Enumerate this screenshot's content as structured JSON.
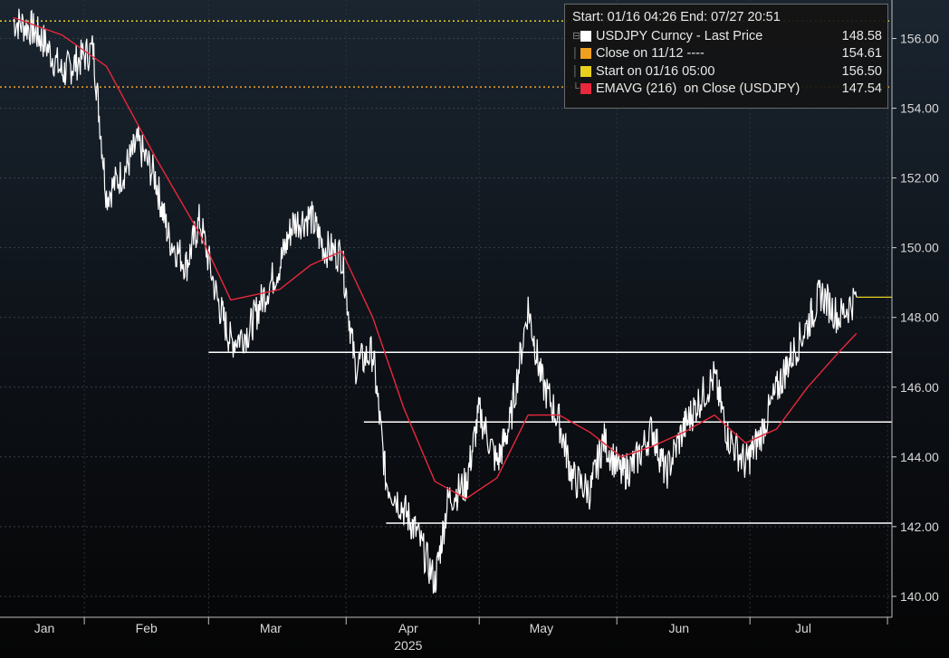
{
  "colors": {
    "background": "#0a0a0a",
    "price_line": "#ffffff",
    "ema_line": "#e8283c",
    "close_marker": "#f0a020",
    "start_marker": "#e8d020",
    "support_lines": "#ffffff",
    "last_price_tick": "#e8d020"
  },
  "legend": {
    "header": "Start: 01/16 04:26 End: 07/27 20:51",
    "items": [
      {
        "label": "USDJPY Curncy - Last Price",
        "value": "148.58",
        "color": "#ffffff"
      },
      {
        "label": "Close on 11/12 ----",
        "value": "154.61",
        "color": "#f0a020"
      },
      {
        "label": "Start on 01/16 05:00",
        "value": "156.50",
        "color": "#e8d020"
      },
      {
        "label": "EMAVG (216)  on Close (USDJPY)",
        "value": "147.54",
        "color": "#e8283c"
      }
    ]
  },
  "chart_data": {
    "type": "line",
    "title": "",
    "ylim": [
      139.4,
      157.0
    ],
    "y_ticks": [
      "140.00",
      "142.00",
      "144.00",
      "146.00",
      "148.00",
      "150.00",
      "152.00",
      "154.00",
      "156.00"
    ],
    "x_months": [
      "Jan",
      "Feb",
      "Mar",
      "Apr",
      "May",
      "Jun",
      "Jul"
    ],
    "x_year": "2025",
    "horizontal_lines": [
      {
        "name": "Close on 11/12",
        "value": 154.61,
        "style": "dotted"
      },
      {
        "name": "Start on 01/16 05:00",
        "value": 156.5,
        "style": "dotted"
      },
      {
        "value": 147.0,
        "from": "03/01"
      },
      {
        "value": 145.0,
        "from": "04/05"
      },
      {
        "value": 142.1,
        "from": "04/10"
      }
    ],
    "series": [
      {
        "name": "USDJPY Curncy - Last Price",
        "x": [
          "01/16",
          "01/20",
          "01/23",
          "01/27",
          "01/30",
          "02/03",
          "02/06",
          "02/10",
          "02/13",
          "02/17",
          "02/20",
          "02/24",
          "02/27",
          "03/03",
          "03/06",
          "03/10",
          "03/13",
          "03/17",
          "03/20",
          "03/24",
          "03/27",
          "03/31",
          "04/03",
          "04/07",
          "04/10",
          "04/14",
          "04/17",
          "04/21",
          "04/24",
          "04/28",
          "05/01",
          "05/05",
          "05/08",
          "05/12",
          "05/15",
          "05/19",
          "05/22",
          "05/26",
          "05/29",
          "06/02",
          "06/05",
          "06/09",
          "06/12",
          "06/16",
          "06/19",
          "06/23",
          "06/26",
          "06/30",
          "07/03",
          "07/07",
          "07/10",
          "07/14",
          "07/17",
          "07/21",
          "07/25"
        ],
        "values": [
          156.5,
          156.3,
          155.9,
          155.0,
          155.3,
          155.7,
          151.5,
          152.2,
          153.0,
          152.0,
          150.3,
          149.5,
          150.8,
          148.5,
          147.3,
          147.6,
          148.5,
          149.5,
          150.7,
          150.9,
          150.0,
          149.8,
          146.6,
          147.0,
          143.3,
          142.5,
          141.8,
          140.4,
          142.8,
          143.2,
          145.3,
          143.8,
          145.0,
          148.3,
          146.2,
          145.0,
          143.4,
          143.0,
          144.5,
          143.5,
          143.8,
          144.8,
          143.5,
          144.8,
          145.5,
          146.3,
          144.6,
          143.8,
          144.5,
          145.9,
          146.8,
          147.8,
          148.7,
          148.0,
          148.58
        ]
      },
      {
        "name": "EMAVG (216)  on Close (USDJPY)",
        "x": [
          "01/16",
          "01/27",
          "02/06",
          "02/17",
          "02/27",
          "03/06",
          "03/17",
          "03/24",
          "03/31",
          "04/07",
          "04/14",
          "04/21",
          "04/28",
          "05/05",
          "05/12",
          "05/19",
          "05/26",
          "06/02",
          "06/09",
          "06/16",
          "06/23",
          "06/30",
          "07/07",
          "07/14",
          "07/21",
          "07/25"
        ],
        "values": [
          156.6,
          156.1,
          155.2,
          152.6,
          150.4,
          148.5,
          148.8,
          149.5,
          149.9,
          148.0,
          145.4,
          143.3,
          142.8,
          143.4,
          145.2,
          145.2,
          144.7,
          144.0,
          144.3,
          144.7,
          145.2,
          144.4,
          144.8,
          146.0,
          147.0,
          147.54
        ]
      }
    ]
  }
}
